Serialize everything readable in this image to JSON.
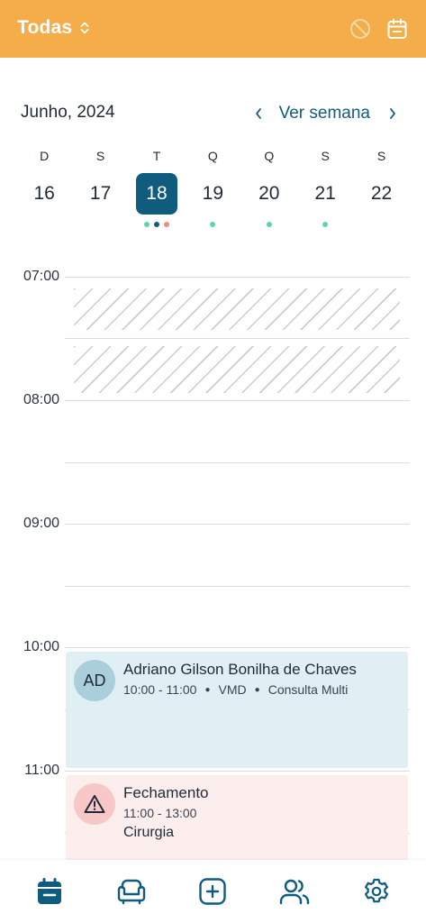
{
  "header": {
    "filter_label": "Todas",
    "background": "#f5ad4a",
    "icons": [
      "block-icon",
      "calendar-icon"
    ]
  },
  "week": {
    "month_label": "Junho, 2024",
    "view_label": "Ver semana",
    "selected_color": "#0f5c7f",
    "days": [
      {
        "dow": "D",
        "date": "16",
        "selected": false,
        "dots": []
      },
      {
        "dow": "S",
        "date": "17",
        "selected": false,
        "dots": []
      },
      {
        "dow": "T",
        "date": "18",
        "selected": true,
        "dots": [
          "#5cd6b0",
          "#0f5c7f",
          "#f08a8a"
        ]
      },
      {
        "dow": "Q",
        "date": "19",
        "selected": false,
        "dots": [
          "#5cd6b0"
        ]
      },
      {
        "dow": "Q",
        "date": "20",
        "selected": false,
        "dots": [
          "#5cd6b0"
        ]
      },
      {
        "dow": "S",
        "date": "21",
        "selected": false,
        "dots": [
          "#5cd6b0"
        ]
      },
      {
        "dow": "S",
        "date": "22",
        "selected": false,
        "dots": []
      }
    ]
  },
  "timeline": {
    "hours": [
      "07:00",
      "08:00",
      "09:00",
      "10:00",
      "11:00"
    ]
  },
  "events": [
    {
      "avatar": "AD",
      "title": "Adriano Gilson Bonilha de Chaves",
      "time": "10:00 - 11:00",
      "unit": "VMD",
      "type": "Consulta Multi"
    },
    {
      "icon": "warning-icon",
      "title": "Fechamento",
      "time": "11:00 - 13:00",
      "subtitle": "Cirurgia"
    }
  ],
  "bottom_nav": {
    "active_color": "#0f5c7f",
    "items": [
      "calendar-icon",
      "armchair-icon",
      "add-icon",
      "users-icon",
      "gear-icon"
    ]
  }
}
